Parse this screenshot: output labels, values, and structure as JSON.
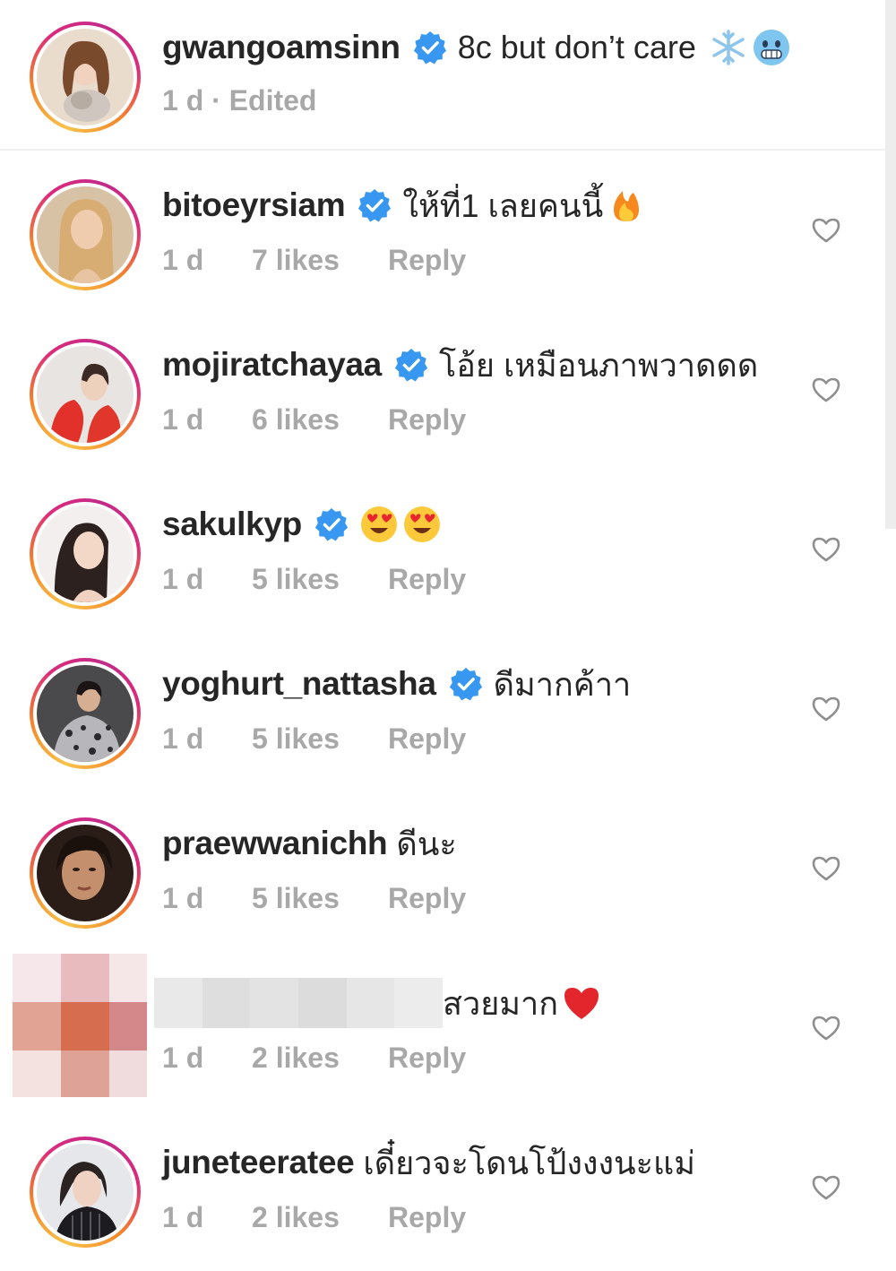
{
  "caption": {
    "username": "gwangoamsinn",
    "verified": true,
    "text": "8c but don’t care",
    "emoji": [
      "snowflake-emoji",
      "cold-face-emoji"
    ],
    "meta": "1 d · Edited"
  },
  "comments": [
    {
      "username": "bitoeyrsiam",
      "verified": true,
      "text": "ให้ที่1 เลยคนนี้",
      "emoji": [
        "fire-emoji"
      ],
      "time": "1 d",
      "likes": "7 likes",
      "reply": "Reply"
    },
    {
      "username": "mojiratchayaa",
      "verified": true,
      "text": "โอ้ย เหมือนภาพวาดดด",
      "emoji": [],
      "time": "1 d",
      "likes": "6 likes",
      "reply": "Reply"
    },
    {
      "username": "sakulkyp",
      "verified": true,
      "text": "",
      "emoji": [
        "heart-eyes-emoji",
        "heart-eyes-emoji"
      ],
      "time": "1 d",
      "likes": "5 likes",
      "reply": "Reply"
    },
    {
      "username": "yoghurt_nattasha",
      "verified": true,
      "text": "ดีมากค้าา",
      "emoji": [],
      "time": "1 d",
      "likes": "5 likes",
      "reply": "Reply"
    },
    {
      "username": "praewwanichh",
      "verified": false,
      "text": "ดีนะ",
      "emoji": [],
      "time": "1 d",
      "likes": "5 likes",
      "reply": "Reply"
    },
    {
      "username": "",
      "verified": false,
      "text": "สวยมาก",
      "emoji": [
        "red-heart-emoji"
      ],
      "time": "1 d",
      "likes": "2 likes",
      "reply": "Reply",
      "redacted": true
    },
    {
      "username": "juneteeratee",
      "verified": false,
      "text": "เดี๋ยวจะโดนโป้งงงนะแม่",
      "emoji": [],
      "time": "1 d",
      "likes": "2 likes",
      "reply": "Reply"
    }
  ],
  "colors": {
    "verified_badge": "#3897f0",
    "meta_text": "#a8a8a8",
    "text": "#262626",
    "heart_outline": "#8e8e8e"
  }
}
